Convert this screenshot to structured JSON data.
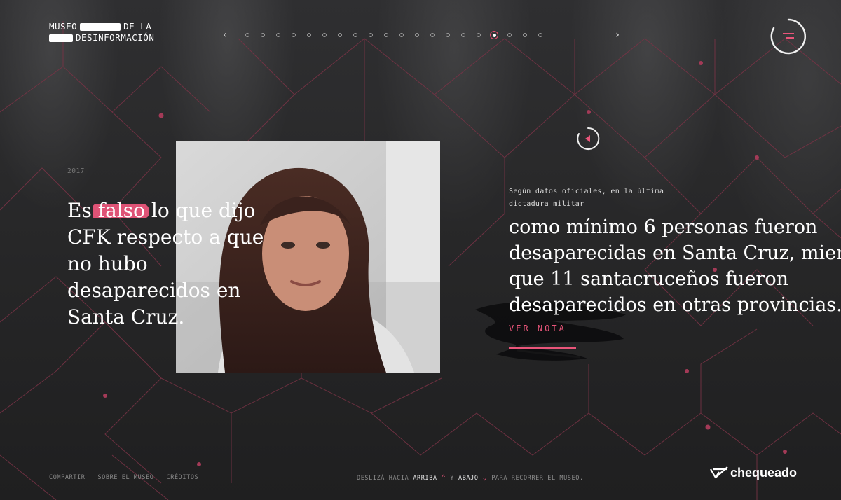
{
  "header": {
    "logo_line1_a": "MUSEO",
    "logo_line1_b": "DE LA",
    "logo_line2": "DESINFORMACIÓN",
    "nav_prev_icon": "chevron-left-icon",
    "nav_next_icon": "chevron-right-icon",
    "dot_count": 20,
    "active_dot_index": 16,
    "menu_icon": "menu-icon"
  },
  "exhibit": {
    "year": "2017",
    "headline_before": "Es ",
    "headline_highlight": "falso",
    "headline_after": " lo que dijo CFK respecto a que no hubo desaparecidos en Santa Cruz.",
    "photo_icon": "portrait-photo",
    "source_line1": "Según datos oficiales, en la última",
    "source_line2": "dictadura militar",
    "fact_line1": "como mínimo 6 personas fueron",
    "fact_line2": "desaparecidas en Santa Cruz, mien",
    "fact_line3": "que 11 santacruceños fueron",
    "fact_line4": "desaparecidos en otras provincias.",
    "ver_nota": "VER NOTA",
    "badge_icon": "rating-badge-icon"
  },
  "footer": {
    "links": [
      "COMPARTIR",
      "SOBRE EL MUSEO",
      "CRÉDITOS"
    ],
    "hint_a": "DESLIZÁ HACIA",
    "hint_up": "ARRIBA",
    "hint_y": "Y",
    "hint_down": "ABAJO",
    "hint_b": "PARA RECORRER EL MUSEO.",
    "brand": "chequeado"
  },
  "colors": {
    "accent": "#e9557a",
    "background": "#2a2a2b"
  }
}
